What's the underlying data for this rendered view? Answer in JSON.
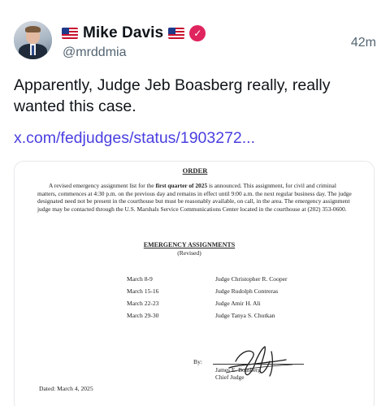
{
  "author": {
    "display_name": "Mike Davis",
    "handle": "@mrddmia",
    "timestamp": "42m",
    "verified_icon": "verified-badge-icon",
    "flag_icon": "us-flag-icon"
  },
  "post": {
    "text": "Apparently, Judge Jeb Boasberg really, really wanted this case.",
    "link": "x.com/fedjudges/status/1903272..."
  },
  "colors": {
    "link": "#4a3fe0",
    "verified": "#e0245e",
    "secondary_text": "#536471"
  },
  "document": {
    "title": "ORDER",
    "para_part1": "A revised emergency assignment list for the ",
    "para_bold": "first quarter of 2025",
    "para_part2": " is announced.  This assignment, for civil and criminal matters, commences at 4:30 p.m. on the previous day and remains in effect until 9:00 a.m. the next regular business day.  The judge designated need not be present in the courthouse but must be reasonably available, on call, in the area.  The emergency assignment judge may be contacted through the U.S. Marshals Service Communications Center located in the courthouse at (202) 353-0600.",
    "section_title": "EMERGENCY ASSIGNMENTS",
    "section_subtitle": "(Revised)",
    "assignments": [
      {
        "date": "March 8-9",
        "judge": "Judge Christopher R. Cooper"
      },
      {
        "date": "March 15-16",
        "judge": "Judge Rudolph Contreras"
      },
      {
        "date": "March 22-23",
        "judge": "Judge Amir H. Ali"
      },
      {
        "date": "March 29-30",
        "judge": "Judge Tanya S. Chutkan"
      }
    ],
    "by_label": "By:",
    "signer_name": "James E. Boasberg",
    "signer_title": "Chief Judge",
    "dated": "Dated: March 4, 2025"
  }
}
